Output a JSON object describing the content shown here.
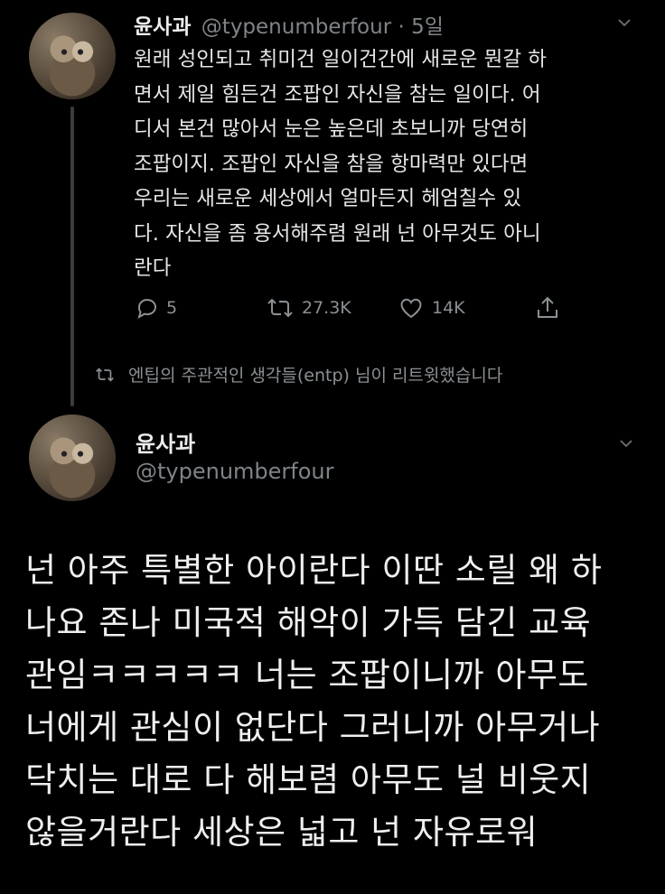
{
  "tweet1": {
    "display_name": "윤사과",
    "handle": "@typenumberfour",
    "separator": "·",
    "time": "5일",
    "text_lines": [
      "원래 성인되고 취미건 일이건간에 새로운 뭔갈 하",
      "면서 제일 힘든건 조팝인 자신을 참는 일이다. 어",
      "디서 본건 많아서 눈은 높은데 초보니까 당연히",
      "조팝이지. 조팝인 자신을 참을 항마력만 있다면",
      "우리는 새로운 세상에서 얼마든지 헤엄칠수 있",
      "다. 자신을 좀 용서해주렴 원래 넌 아무것도 아니",
      "란다"
    ],
    "replies": "5",
    "retweets": "27.3K",
    "likes": "14K"
  },
  "retweet_notice": "엔팁의 주관적인 생각들(entp) 님이 리트윗했습니다",
  "tweet2": {
    "display_name": "윤사과",
    "handle": "@typenumberfour",
    "text_lines": [
      "넌 아주 특별한 아이란다 이딴 소릴 왜 하",
      "나요 존나 미국적 해악이 가득 담긴 교육",
      "관임ㅋㅋㅋㅋㅋ 너는 조팝이니까 아무도",
      "너에게 관심이 없단다 그러니까 아무거나",
      "닥치는 대로 다 해보렴 아무도 널 비웃지",
      "않을거란다 세상은 넓고 넌 자유로워"
    ]
  },
  "icons": {
    "reply": "reply-icon",
    "retweet": "retweet-icon",
    "like": "heart-icon",
    "share": "share-icon",
    "more": "chevron-down-icon"
  },
  "colors": {
    "background": "#000000",
    "text": "#e6e6e6",
    "muted": "#8b9094"
  }
}
